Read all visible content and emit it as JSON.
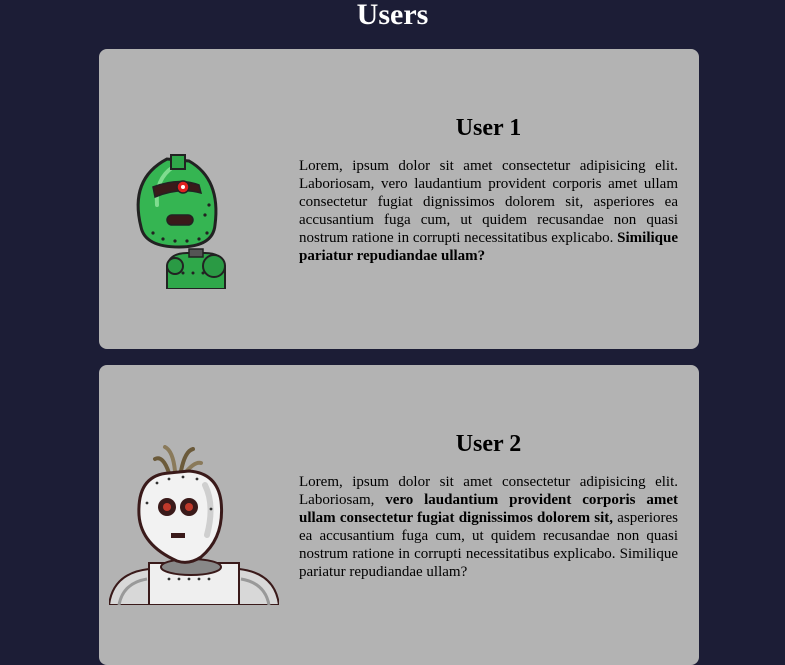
{
  "page": {
    "title": "Users"
  },
  "users": [
    {
      "name": "User 1",
      "bio_plain_1": "Lorem, ipsum dolor sit amet consectetur adipisicing elit. Laboriosam, vero laudantium provident corporis amet ullam consectetur fugiat dignissimos dolorem sit, asperiores ea accusantium fuga cum, ut quidem recusandae non quasi nostrum ratione in corrupti necessitatibus explicabo.",
      "bio_bold": "Similique pariatur repudiandae ullam?",
      "avatar_icon": "green-robot-icon"
    },
    {
      "name": "User 2",
      "bio_plain_1": "Lorem, ipsum dolor sit amet consectetur adipisicing elit. Laboriosam,",
      "bio_bold": "vero laudantium provident corporis amet ullam consectetur fugiat dignissimos dolorem sit,",
      "bio_plain_2": "asperiores ea accusantium fuga cum, ut quidem recusandae non quasi nostrum ratione in corrupti necessitatibus explicabo. Similique pariatur repudiandae ullam?",
      "avatar_icon": "white-robot-icon"
    }
  ],
  "colors": {
    "background": "#1c1d36",
    "card": "#b3b3b3",
    "title": "#ffffff"
  }
}
